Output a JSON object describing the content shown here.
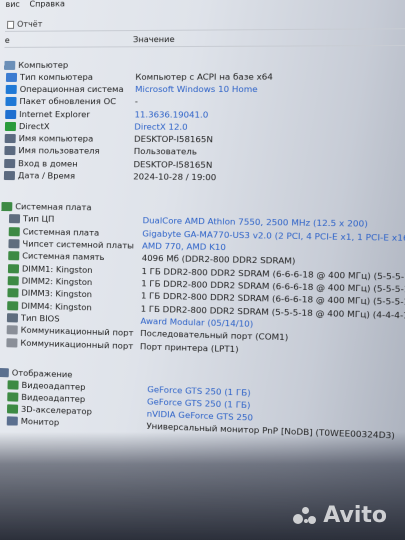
{
  "menu": {
    "item1": "вис",
    "item2": "Справка"
  },
  "toolbar": {
    "report": "Отчёт"
  },
  "columns": {
    "field": "е",
    "value": "Значение"
  },
  "rows": [
    {
      "label": "Компьютер",
      "value": ""
    },
    {
      "label": "Тип компьютера",
      "value": "Компьютер с ACPI на базе x64"
    },
    {
      "label": "Операционная система",
      "value": "Microsoft Windows 10 Home"
    },
    {
      "label": "Пакет обновления ОС",
      "value": "-"
    },
    {
      "label": "Internet Explorer",
      "value": "11.3636.19041.0"
    },
    {
      "label": "DirectX",
      "value": "DirectX 12.0"
    },
    {
      "label": "Имя компьютера",
      "value": "DESKTOP-I58165N"
    },
    {
      "label": "Имя пользователя",
      "value": "Пользователь"
    },
    {
      "label": "Вход в домен",
      "value": "DESKTOP-I58165N"
    },
    {
      "label": "Дата / Время",
      "value": "2024-10-28 / 19:00"
    },
    {
      "label": "Системная плата",
      "value": ""
    },
    {
      "label": "Тип ЦП",
      "value": "DualCore AMD Athlon 7550, 2500 MHz (12.5 x 200)"
    },
    {
      "label": "Системная плата",
      "value": "Gigabyte GA-MA770-US3 v2.0  (2 PCI, 4 PCI-E x1, 1 PCI-E x16, 4 DD..."
    },
    {
      "label": "Чипсет системной платы",
      "value": "AMD 770, AMD K10"
    },
    {
      "label": "Системная память",
      "value": "4096 Мб  (DDR2-800 DDR2 SDRAM)"
    },
    {
      "label": "DIMM1: Kingston",
      "value": "1 ГБ DDR2-800 DDR2 SDRAM  (6-6-6-18 @ 400 МГц)  (5-5-5-15 @ 3..."
    },
    {
      "label": "DIMM2: Kingston",
      "value": "1 ГБ DDR2-800 DDR2 SDRAM  (6-6-6-18 @ 400 МГц)  (5-5-5-15 @ 3..."
    },
    {
      "label": "DIMM3: Kingston",
      "value": "1 ГБ DDR2-800 DDR2 SDRAM  (6-6-6-18 @ 400 МГц)  (5-5-5-15 @ 3..."
    },
    {
      "label": "DIMM4: Kingston",
      "value": "1 ГБ DDR2-800 DDR2 SDRAM  (5-5-5-18 @ 400 МГц)  (4-4-4-12 @ 2..."
    },
    {
      "label": "Тип BIOS",
      "value": "Award Modular (05/14/10)"
    },
    {
      "label": "Коммуникационный порт",
      "value": "Последовательный порт (COM1)"
    },
    {
      "label": "Коммуникационный порт",
      "value": "Порт принтера (LPT1)"
    },
    {
      "label": "Отображение",
      "value": ""
    },
    {
      "label": "Видеоадаптер",
      "value": "GeForce GTS 250  (1 ГБ)"
    },
    {
      "label": "Видеоадаптер",
      "value": "GeForce GTS 250  (1 ГБ)"
    },
    {
      "label": "3D-акселератор",
      "value": "nVIDIA GeForce GTS 250"
    },
    {
      "label": "Монитор",
      "value": "Универсальный монитор PnP [NoDB]  (T0WEE00324D3)"
    }
  ],
  "watermark": {
    "text": "Avito"
  },
  "colors": {
    "link": "#2d62c8",
    "text": "#1e1e1e"
  }
}
